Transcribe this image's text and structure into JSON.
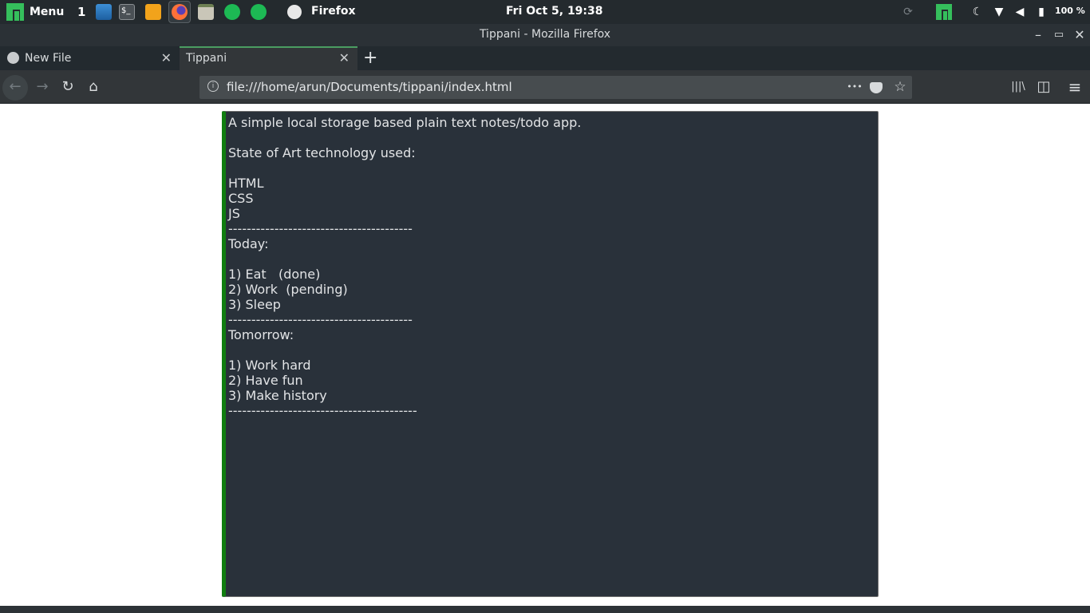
{
  "panel": {
    "menu_label": "Menu",
    "workspace": "1",
    "active_app": "Firefox",
    "clock": "Fri Oct  5, 19:38",
    "battery_pct": "100 %",
    "tray_icons": [
      "sync-icon",
      "manjaro-settings-icon",
      "night-mode-icon",
      "wifi-icon",
      "volume-icon",
      "battery-icon"
    ],
    "taskbar_icons": [
      "file-manager-icon",
      "terminal-icon",
      "sublime-text-icon",
      "firefox-icon",
      "archive-manager-icon",
      "spotify-icon",
      "spotify-icon-2"
    ]
  },
  "window": {
    "title": "Tippani - Mozilla Firefox",
    "minimize": "–",
    "maximize": "▭",
    "close": "✕"
  },
  "tabs": [
    {
      "label": "New File",
      "active": false,
      "icon": "github-icon"
    },
    {
      "label": "Tippani",
      "active": true
    }
  ],
  "tab_close_glyph": "✕",
  "new_tab_glyph": "+",
  "navbar": {
    "url": "file:///home/arun/Documents/tippani/index.html",
    "back": "←",
    "forward": "→",
    "reload": "↻",
    "home": "⌂",
    "page_actions": "•••",
    "bookmark": "☆",
    "library": "|||\\",
    "sidebar": "◫",
    "menu": "≡"
  },
  "note": {
    "text": "A simple local storage based plain text notes/todo app.\n\nState of Art technology used:\n\nHTML\nCSS\nJS\n----------------------------------------\nToday:\n\n1) Eat   (done)\n2) Work  (pending)\n3) Sleep\n----------------------------------------\nTomorrow:\n\n1) Work hard\n2) Have fun\n3) Make history\n-----------------------------------------"
  },
  "colors": {
    "panel_bg": "#242a2e",
    "note_bg": "#29313a",
    "note_border_accent": "#107e10",
    "manjaro_green": "#35bf5c"
  }
}
